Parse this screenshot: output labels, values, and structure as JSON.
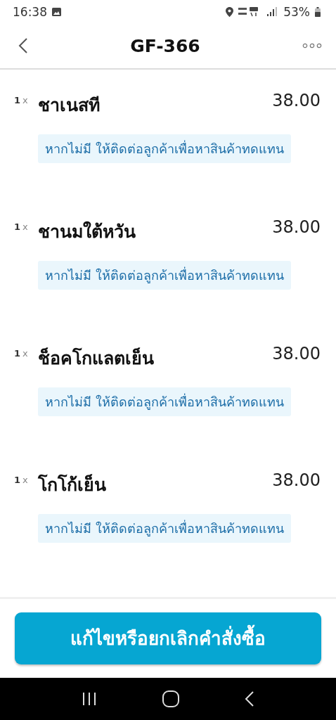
{
  "status_bar": {
    "time": "16:38",
    "battery": "53%"
  },
  "header": {
    "title": "GF-366"
  },
  "items": [
    {
      "quantity": "1",
      "multiplier": "x",
      "name": "ชาเนสที",
      "price": "38.00",
      "note": "หากไม่มี ให้ติดต่อลูกค้าเพื่อหาสินค้าทดแทน"
    },
    {
      "quantity": "1",
      "multiplier": "x",
      "name": "ชานมใต้หวัน",
      "price": "38.00",
      "note": "หากไม่มี ให้ติดต่อลูกค้าเพื่อหาสินค้าทดแทน"
    },
    {
      "quantity": "1",
      "multiplier": "x",
      "name": "ช็อคโกแลตเย็น",
      "price": "38.00",
      "note": "หากไม่มี ให้ติดต่อลูกค้าเพื่อหาสินค้าทดแทน"
    },
    {
      "quantity": "1",
      "multiplier": "x",
      "name": "โกโก้เย็น",
      "price": "38.00",
      "note": "หากไม่มี ให้ติดต่อลูกค้าเพื่อหาสินค้าทดแทน"
    }
  ],
  "footer": {
    "button": "แก้ไขหรือยกเลิกคำสั่งซื้อ"
  }
}
